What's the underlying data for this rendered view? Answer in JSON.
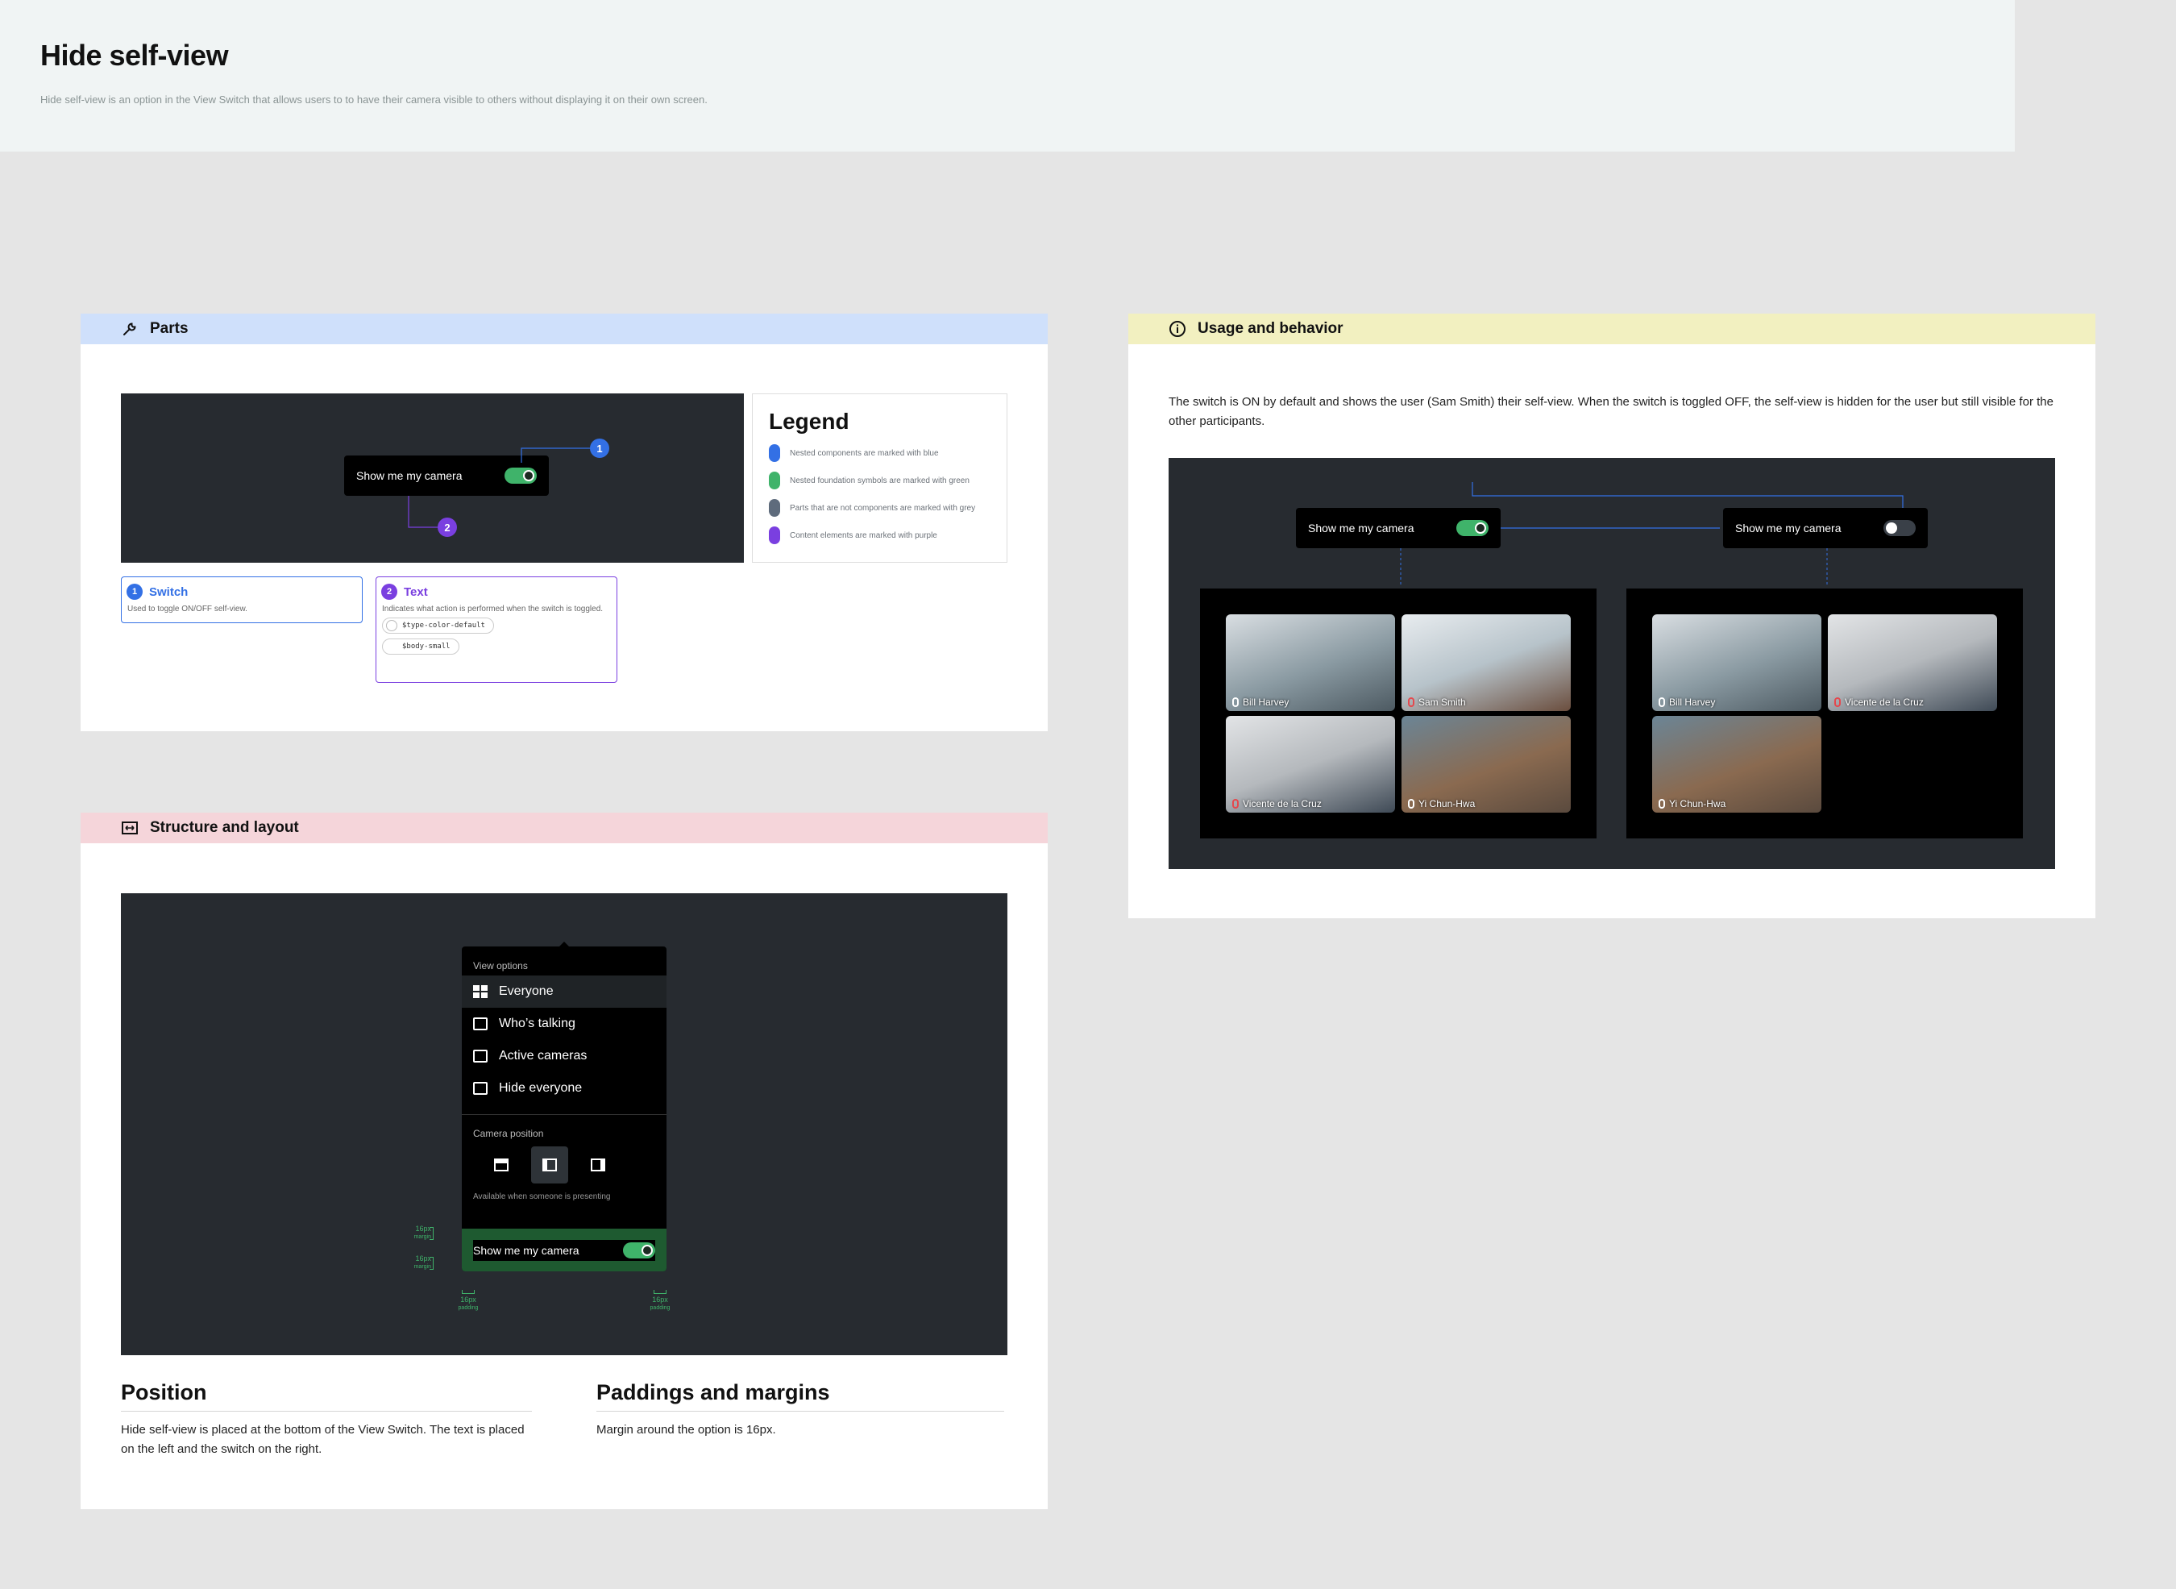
{
  "header": {
    "title": "Hide self-view",
    "description": "Hide self-view is an option in the View Switch that allows users to to have their camera visible to others without displaying it on their own screen."
  },
  "parts": {
    "title": "Parts",
    "icon": "wrench-icon",
    "band_color": "#cfe0fb",
    "toggle_label": "Show me my camera",
    "marker1": "1",
    "marker2": "2",
    "legend": {
      "title": "Legend",
      "items": [
        {
          "label": "Nested components are marked with blue",
          "color": "#3370e5"
        },
        {
          "label": "Nested foundation symbols are marked with green",
          "color": "#3fb36a"
        },
        {
          "label": "Parts that are not components are marked with grey",
          "color": "#5e6b7c"
        },
        {
          "label": "Content elements are marked with purple",
          "color": "#7a3fe0"
        }
      ]
    },
    "switch_card": {
      "num": "1",
      "title": "Switch",
      "desc": "Used to toggle ON/OFF self-view."
    },
    "text_card": {
      "num": "2",
      "title": "Text",
      "desc": "Indicates what action is performed when the switch is toggled.",
      "tokens": [
        "$type-color-default",
        "$body-small"
      ]
    }
  },
  "usage": {
    "title": "Usage and behavior",
    "icon": "info-icon",
    "band_color": "#f2f0c0",
    "description": "The switch is ON by default and shows the user (Sam Smith) their self-view. When the switch is toggled OFF, the self-view is hidden for the user but still visible for the other participants.",
    "left_toggle_label": "Show me my camera",
    "right_toggle_label": "Show me my camera",
    "left_tiles": [
      {
        "name": "Bill Harvey",
        "muted": false
      },
      {
        "name": "Sam Smith",
        "muted": true
      },
      {
        "name": "Vicente de la Cruz",
        "muted": true
      },
      {
        "name": "Yi Chun-Hwa",
        "muted": false
      }
    ],
    "right_tiles": [
      {
        "name": "Bill Harvey",
        "muted": false
      },
      {
        "name": "Vicente de la Cruz",
        "muted": true
      },
      {
        "name": "Yi Chun-Hwa",
        "muted": false
      }
    ]
  },
  "structure": {
    "title": "Structure and layout",
    "icon": "layout-icon",
    "band_color": "#f5d5da",
    "menu": {
      "view_options_label": "View options",
      "items": [
        "Everyone",
        "Who’s talking",
        "Active cameras",
        "Hide everyone"
      ],
      "camera_position_label": "Camera position",
      "available_note": "Available when someone is presenting",
      "toggle_label": "Show me my camera"
    },
    "annotations": {
      "margin_value": "16px",
      "margin_word": "margin",
      "padding_value": "16px",
      "padding_word": "padding"
    },
    "position": {
      "title": "Position",
      "text": "Hide self-view is placed at the bottom of the View Switch. The text is placed on the left and the switch on the right."
    },
    "paddings": {
      "title": "Paddings and margins",
      "text": "Margin around the option is 16px."
    }
  }
}
